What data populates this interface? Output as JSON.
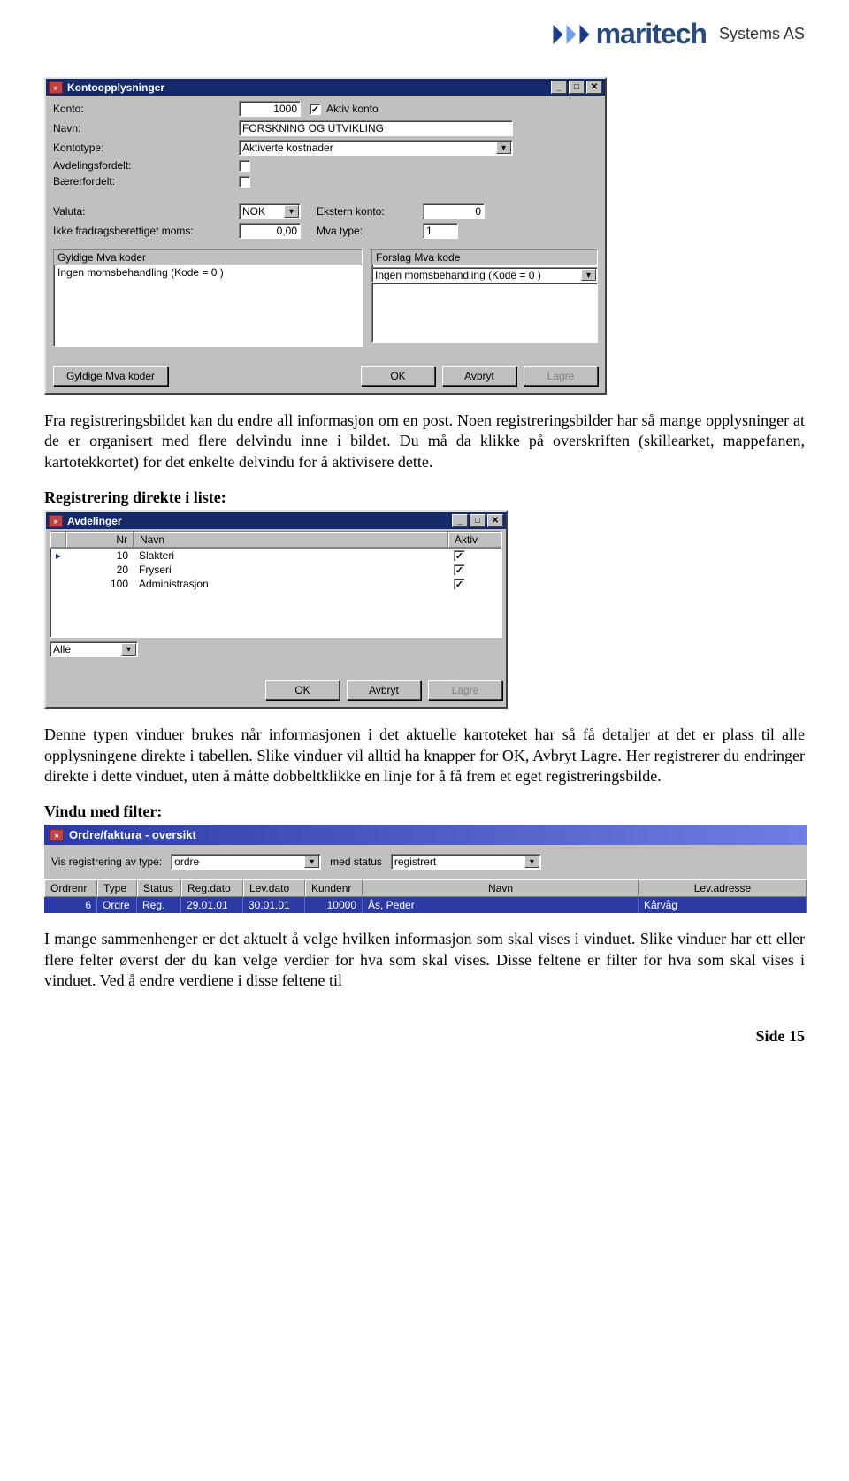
{
  "header": {
    "brand": "maritech",
    "suffix": "Systems AS"
  },
  "dialog1": {
    "title": "Kontoopplysninger",
    "rows": {
      "konto_label": "Konto:",
      "konto_value": "1000",
      "aktiv_konto_label": "Aktiv konto",
      "navn_label": "Navn:",
      "navn_value": "FORSKNING OG UTVIKLING",
      "kontotype_label": "Kontotype:",
      "kontotype_value": "Aktiverte kostnader",
      "avd_label": "Avdelingsfordelt:",
      "baerer_label": "Bærerfordelt:",
      "valuta_label": "Valuta:",
      "valuta_value": "NOK",
      "ekstern_label": "Ekstern konto:",
      "ekstern_value": "0",
      "moms_label": "Ikke fradragsberettiget moms:",
      "moms_value": "0,00",
      "mvatype_label": "Mva type:",
      "mvatype_value": "1",
      "gyldige_header": "Gyldige Mva koder",
      "gyldige_value": "Ingen momsbehandling   (Kode = 0 )",
      "forslag_header": "Forslag Mva kode",
      "forslag_value": "Ingen momsbehandling   (Kode = 0 )",
      "btn_gyldige": "Gyldige Mva koder",
      "btn_ok": "OK",
      "btn_avbryt": "Avbryt",
      "btn_lagre": "Lagre"
    }
  },
  "para1": "Fra registreringsbildet kan du endre all informasjon om en post. Noen registreringsbilder har så mange opplysninger at de er organisert med flere delvindu inne i bildet. Du må da klikke på overskriften (skillearket, mappefanen, kartotekkortet) for det enkelte delvindu for å aktivisere dette.",
  "heading1": "Registrering direkte i liste:",
  "dialog2": {
    "title": "Avdelinger",
    "col_nr": "Nr",
    "col_navn": "Navn",
    "col_aktiv": "Aktiv",
    "rows": [
      {
        "nr": "10",
        "navn": "Slakteri",
        "aktiv": true
      },
      {
        "nr": "20",
        "navn": "Fryseri",
        "aktiv": true
      },
      {
        "nr": "100",
        "navn": "Administrasjon",
        "aktiv": true
      }
    ],
    "combo_value": "Alle",
    "btn_ok": "OK",
    "btn_avbryt": "Avbryt",
    "btn_lagre": "Lagre"
  },
  "para2": "Denne typen vinduer brukes når informasjonen i det aktuelle kartoteket har så få detaljer at det er plass til alle opplysningene direkte i tabellen. Slike vinduer vil alltid ha knapper for OK, Avbryt Lagre. Her registrerer du endringer direkte i dette vinduet, uten å måtte dobbeltklikke en linje for å få frem et eget registreringsbilde.",
  "heading2": "Vindu med filter:",
  "ordre": {
    "title": "Ordre/faktura - oversikt",
    "filter_label1": "Vis registrering av type:",
    "filter_value1": "ordre",
    "filter_label2": "med status",
    "filter_value2": "registrert",
    "cols": {
      "ordrenr": "Ordrenr",
      "type": "Type",
      "status": "Status",
      "regdato": "Reg.dato",
      "levdato": "Lev.dato",
      "kundenr": "Kundenr",
      "navn": "Navn",
      "levadr": "Lev.adresse"
    },
    "row": {
      "ordrenr": "6",
      "type": "Ordre",
      "status": "Reg.",
      "regdato": "29.01.01",
      "levdato": "30.01.01",
      "kundenr": "10000",
      "navn": "Ås, Peder",
      "levadr": "Kårvåg"
    }
  },
  "para3": "I mange sammenhenger er det aktuelt å velge hvilken informasjon som skal vises i vinduet. Slike vinduer har ett eller flere felter øverst der du kan velge verdier for hva som skal vises. Disse feltene er filter for hva som skal vises i vinduet. Ved å endre verdiene i disse feltene til",
  "footer": "Side 15"
}
